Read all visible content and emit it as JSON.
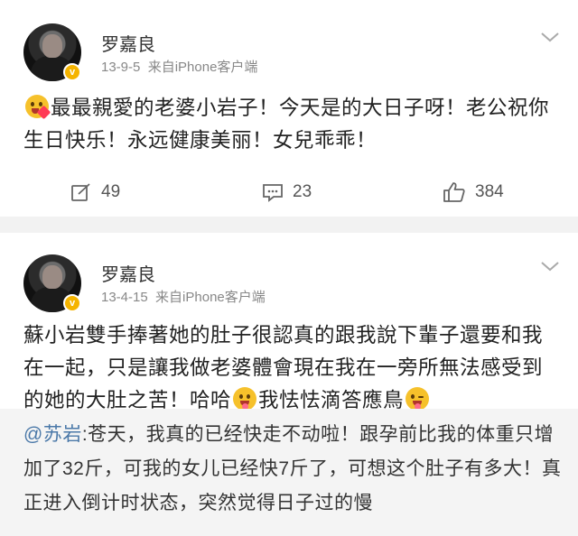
{
  "posts": [
    {
      "author": "罗嘉良",
      "verified_badge": "v",
      "time": "13-9-5",
      "source": "来自iPhone客户端",
      "text_before_emoji": "",
      "text": "最最親愛的老婆小岩子！今天是的大日子呀！老公祝你生日快乐！永远健康美丽！女兒乖乖！",
      "repost_count": "49",
      "comment_count": "23",
      "like_count": "384"
    },
    {
      "author": "罗嘉良",
      "verified_badge": "v",
      "time": "13-4-15",
      "source": "来自iPhone客户端",
      "text_part1": "蘇小岩雙手捧著她的肚子很認真的跟我說下輩子還要和我在一起，只是讓我做老婆體會現在我在一旁所無法感受到的她的大肚之苦！哈哈",
      "text_part2": "我怯怯滴答應鳥",
      "quoted": {
        "mention": "@苏岩",
        "text": ":苍天，我真的已经快走不动啦！跟孕前比我的体重只增加了32斤，可我的女儿已经快7斤了，可想这个肚子有多大！真正进入倒计时状态，突然觉得日子过的慢"
      }
    }
  ],
  "colors": {
    "background": "#f2f2f2",
    "card": "#ffffff",
    "mention": "#4a78a8",
    "badge": "#f5b400"
  },
  "icons": [
    "chevron-down-icon",
    "repost-icon",
    "comment-icon",
    "like-icon",
    "blush-heart-emoji",
    "tongue-emoji",
    "wink-tongue-emoji"
  ]
}
